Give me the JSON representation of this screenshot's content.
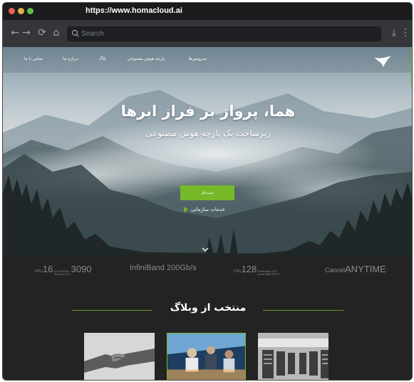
{
  "browser": {
    "title_url": "https://www.homacloud.ai",
    "address_placeholder": "Search"
  },
  "nav": {
    "items": [
      {
        "label": "سرویس‌ها"
      },
      {
        "label": "پارچه هوش مصنوعی"
      },
      {
        "label": "بلاگ"
      },
      {
        "label": "درباره ما"
      },
      {
        "label": "تماس با ما"
      }
    ],
    "logo": "homa-bird-logo"
  },
  "hero": {
    "title": "هما، پرواز بر فراز ابرها",
    "subtitle": "زیرساخت یک پارچه هوش مصنوعی",
    "cta_label": "ثبت‌نام",
    "services_link": "خدمات سازمانی"
  },
  "stats": [
    {
      "prefix": "GPU",
      "number": "16",
      "tiny_top": "GX H100SA",
      "tiny_bottom": "Geforce RTX",
      "value": "3090"
    },
    {
      "prefix": "",
      "number": "",
      "tiny_top": "",
      "tiny_bottom": "",
      "value": "InfiniBand 200Gb/s"
    },
    {
      "prefix": "CPU",
      "number": "128",
      "tiny_top": "Dedicated CPU",
      "tiny_bottom": "cores AMD EPYC",
      "value": ""
    },
    {
      "prefix": "Cancel",
      "number": "",
      "tiny_top": "",
      "tiny_bottom": "",
      "value": "ANYTIME"
    }
  ],
  "blog": {
    "heading": "منتخب از وبلاگ"
  },
  "colors": {
    "accent": "#77b82a",
    "dark_bg": "#232323",
    "browser_chrome": "#35363a"
  }
}
